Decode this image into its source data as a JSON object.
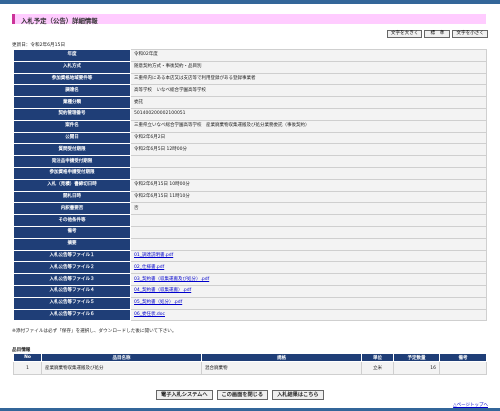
{
  "page_title": "入札予定（公告）詳細情報",
  "font_buttons": [
    "文字を大きく",
    "標　準",
    "文字を小さく"
  ],
  "updated": "更新日：令和2年6月15日",
  "details": [
    {
      "label": "年度",
      "value": "令和02年度"
    },
    {
      "label": "入札方式",
      "value": "随意契約方式・事後契約・品目別"
    },
    {
      "label": "参加資格地域要件等",
      "value": "三重県内にある本店又は支店等で利用登録がある登録事業者"
    },
    {
      "label": "調達名",
      "value": "高等学校　いなべ総合学園高等学校"
    },
    {
      "label": "業種分類",
      "value": "委託"
    },
    {
      "label": "契約管理番号",
      "value": "50140020000210005​1"
    },
    {
      "label": "案件名",
      "value": "三重県立いなべ総合学園高等学校　産業廃棄物収集運搬及び処分業務委託（事後契約）"
    },
    {
      "label": "公開日",
      "value": "令和2年6月2日"
    },
    {
      "label": "質問受付期限",
      "value": "令和2年6月5日 12時00分"
    },
    {
      "label": "発注品申請受付期限",
      "value": ""
    },
    {
      "label": "参加資格申請受付期限",
      "value": ""
    },
    {
      "label": "入札（見積）書締切日時",
      "value": "令和2年6月15日 10時00分"
    },
    {
      "label": "開札日時",
      "value": "令和2年6月15日 11時10分"
    },
    {
      "label": "内訳書要否",
      "value": "否"
    },
    {
      "label": "その他条件等",
      "value": ""
    },
    {
      "label": "備考",
      "value": ""
    },
    {
      "label": "摘要",
      "value": ""
    },
    {
      "label": "入札公告等ファイル１",
      "value": "01_調達説明書.pdf"
    },
    {
      "label": "入札公告等ファイル２",
      "value": "02_仕様書.pdf"
    },
    {
      "label": "入札公告等ファイル３",
      "value": "03_契約書（収集運搬及び処分）.pdf"
    },
    {
      "label": "入札公告等ファイル４",
      "value": "04_契約書（収集運搬）.pdf"
    },
    {
      "label": "入札公告等ファイル５",
      "value": "05_契約書（処分）.pdf"
    },
    {
      "label": "入札公告等ファイル６",
      "value": "06_委任状.doc"
    }
  ],
  "download_note": "※添付ファイルは必ず「保存」を選択し、ダウンロードした後に開いて下さい。",
  "items_label": "品目情報",
  "items_headers": [
    "No",
    "品目名称",
    "規格",
    "単位",
    "予定数量",
    "備考"
  ],
  "items_rows": [
    [
      "1",
      "産業廃棄物収集運搬及び処分",
      "混合廃棄物",
      "立米",
      "16",
      ""
    ]
  ],
  "action_buttons": [
    "電子入札システムへ",
    "この画面を閉じる",
    "入札結果はこちら"
  ],
  "pagetop": "△ページトップへ",
  "colors": {
    "header_bg": "#1f3e77",
    "title_band": "#ffccff",
    "top_bar": "#336699",
    "link": "#0000cc"
  }
}
